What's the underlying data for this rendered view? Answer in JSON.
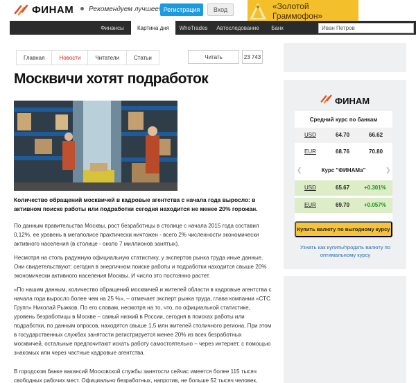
{
  "header": {
    "logo_text": "ФИНАМ",
    "tagline": "Рекомендуем лучшее!",
    "register_label": "Регистрация",
    "login_label": "Вход",
    "banner_text": "«Золотой Граммофон»"
  },
  "nav": {
    "items": [
      "Финансы",
      "Картина дня",
      "WhoTrades",
      "Автоследование",
      "Банк"
    ],
    "search_value": "Иван Петров"
  },
  "tabs": [
    "Главная",
    "Новости",
    "Читатели",
    "Статьи"
  ],
  "read": {
    "label": "Читать",
    "count": "23 743"
  },
  "article": {
    "title": "Москвичи хотят подработок",
    "lead": "Количество обращений москвичей в кадровые агентства с начала года выросло: в активном поиске работы или подработки сегодня находится не менее 20% горожан.",
    "paragraphs": [
      "По данным правительства Москвы, рост безработицы в столице с начала 2015 года составил 0,12%, ее уровень в мегаполисе практически ничтожен - всего 2% численности экономически активного населения (в столице - около 7 миллионов занятых).",
      "Несмотря на столь радужную официальную статистику, у экспертов рынка труда иные данные. Они свидетельствуют: сегодня в энергичном поиске работы и подработки находится свыше 20% экономически активного населения Москвы. И число это постоянно растет.",
      "«По нашим данным, количество обращений москвичей и жителей области в кадровые агентства с начала года выросло более чем на 25 %», – отмечает эксперт рынка труда, глава компании «СТС Групп» Николай Рыжков. По его словам, несмотря на то, что, по официальной статистике, уровень безработицы в Москве – самый низкий в России, сегодня в поисках работы или подработки, по данным опросов, находятся свыше 1,5 млн жителей столичного региона. При этом в государственных службах занятости регистрируется менее 20% из всех безработных москвичей, остальные предпочитают искать работу самостоятельно – через интернет, с помощью знакомых или через частные кадровые агентства.",
      "В городском банке вакансий Московской службы занятости сейчас имеется более 115 тысяч свободных рабочих мест. Официально безработных, напротив, не больше 52 тысяч человек, почти"
    ]
  },
  "widget": {
    "logo_text": "ФИНАМ",
    "bank_title": "Средний курс по банкам",
    "bank_rates": [
      {
        "currency": "USD",
        "buy": "64.70",
        "sell": "66.62"
      },
      {
        "currency": "EUR",
        "buy": "68.76",
        "sell": "70.80"
      }
    ],
    "finam_title": "Курс \"ФИНАМа\"",
    "finam_rates": [
      {
        "currency": "USD",
        "rate": "65.67",
        "change": "+0.301%"
      },
      {
        "currency": "EUR",
        "rate": "69.70",
        "change": "+0.057%"
      }
    ],
    "buy_button": "Купить валюту по выгодному курсу",
    "howto_link": "Узнать как купить/продать валюту по оптимальному курсу"
  },
  "colors": {
    "accent_blue": "#1a9be0",
    "nav_dark": "#2b2b2b",
    "banner_gold": "#f3c02c",
    "positive_green": "#1a8f1a",
    "finam_red": "#e8462a"
  }
}
